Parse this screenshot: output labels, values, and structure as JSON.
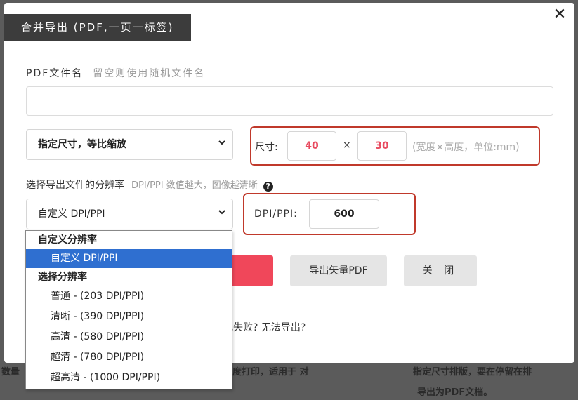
{
  "background": {
    "left_text": "数量",
    "middle_text": "度打印，适用于 对",
    "right_text_1": "指定尺寸排版，要在停留在排",
    "right_text_2": "导出为PDF文档。"
  },
  "dialog": {
    "title": "合并导出 (PDF,一页一标签)",
    "close_symbol": "✕",
    "filename": {
      "label": "PDF文件名",
      "hint": "留空则使用随机文件名",
      "value": ""
    },
    "size_mode": {
      "selected": "指定尺寸，等比缩放"
    },
    "size": {
      "label": "尺寸:",
      "width": "40",
      "times": "×",
      "height": "30",
      "unit_hint": "(宽度×高度，单位:mm)"
    },
    "resolution": {
      "label": "选择导出文件的分辨率",
      "hint": "DPI/PPI 数值越大，图像越清晰",
      "help_symbol": "?",
      "selected": "自定义 DPI/PPI",
      "dpi_label": "DPI/PPI:",
      "dpi_value": "600"
    },
    "buttons": {
      "export_vector": "导出矢量PDF",
      "close": "关 闭"
    },
    "fail_link": "或失败? 无法导出?"
  },
  "dropdown": {
    "group_custom": "自定义分辨率",
    "option_custom": "自定义 DPI/PPI",
    "group_presets": "选择分辨率",
    "options": [
      "普通 - (203 DPI/PPI)",
      "清晰 - (390 DPI/PPI)",
      "高清 - (580 DPI/PPI)",
      "超清 - (780 DPI/PPI)",
      "超高清 - (1000 DPI/PPI)"
    ]
  },
  "colors": {
    "accent_red": "#f0475a",
    "highlight_border": "#c0392b",
    "value_red": "#e84a5f",
    "selected_blue": "#2f6fd0"
  }
}
